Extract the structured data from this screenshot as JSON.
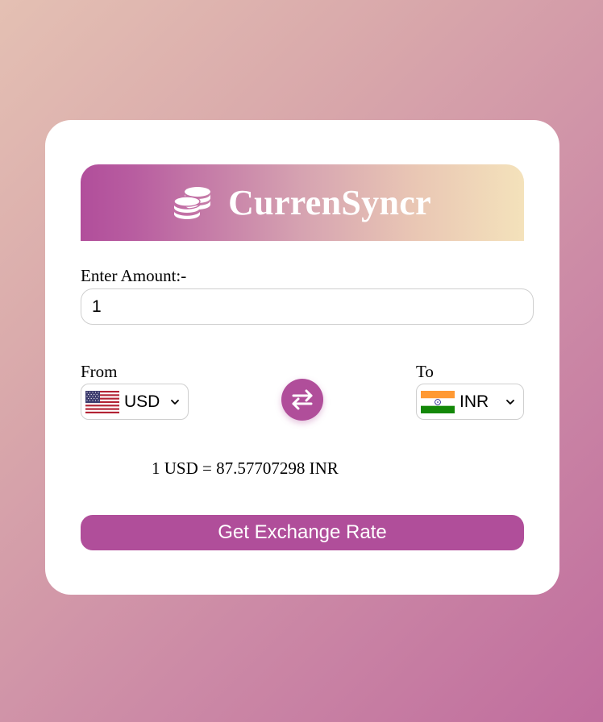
{
  "app": {
    "title": "CurrenSyncr",
    "logo_icon": "coins-icon"
  },
  "amount": {
    "label": "Enter Amount:-",
    "value": "1"
  },
  "from": {
    "label": "From",
    "currency": "USD",
    "flag_icon": "us-flag-icon"
  },
  "to": {
    "label": "To",
    "currency": "INR",
    "flag_icon": "india-flag-icon"
  },
  "swap": {
    "icon": "swap-arrows-icon"
  },
  "result": {
    "text": "1 USD = 87.57707298 INR"
  },
  "actions": {
    "get_rate_label": "Get Exchange Rate"
  },
  "colors": {
    "accent": "#b04e9a",
    "header_gradient_start": "#b14e9b",
    "header_gradient_end": "#f4e2bb",
    "card": "#ffffff"
  }
}
